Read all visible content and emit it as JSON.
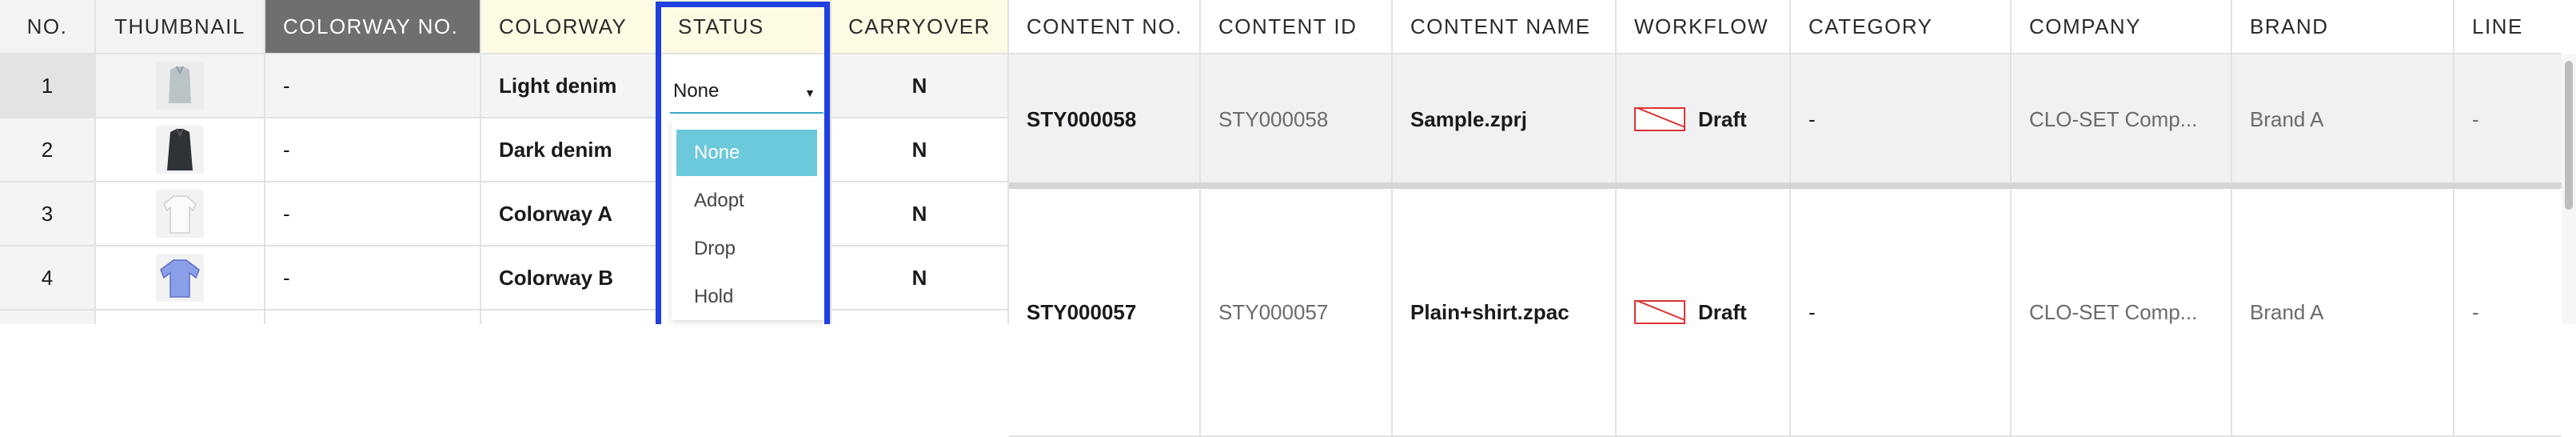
{
  "columns": {
    "no": "NO.",
    "thumbnail": "THUMBNAIL",
    "colorway_no": "COLORWAY NO.",
    "colorway": "COLORWAY",
    "status": "STATUS",
    "carryover": "CARRYOVER",
    "content_no": "CONTENT NO.",
    "content_id": "CONTENT ID",
    "content_name": "CONTENT NAME",
    "workflow": "WORKFLOW",
    "category": "CATEGORY",
    "company": "COMPANY",
    "brand": "BRAND",
    "line": "LINE"
  },
  "colorway_rows": [
    {
      "no": "1",
      "colorway_no": "-",
      "colorway": "Light denim",
      "carryover": "N",
      "thumb": "light-denim-garment-icon"
    },
    {
      "no": "2",
      "colorway_no": "-",
      "colorway": "Dark denim",
      "carryover": "N",
      "thumb": "dark-denim-garment-icon"
    },
    {
      "no": "3",
      "colorway_no": "-",
      "colorway": "Colorway A",
      "carryover": "N",
      "thumb": "white-shirt-icon"
    },
    {
      "no": "4",
      "colorway_no": "-",
      "colorway": "Colorway B",
      "carryover": "N",
      "thumb": "blue-shirt-icon"
    }
  ],
  "status_select": {
    "value": "None",
    "options": [
      "None",
      "Adopt",
      "Drop",
      "Hold"
    ],
    "selected_index": 0
  },
  "content_rows": [
    {
      "content_no": "STY000058",
      "content_id": "STY000058",
      "content_name": "Sample.zprj",
      "workflow": "Draft",
      "category": "-",
      "company": "CLO-SET Comp...",
      "brand": "Brand A",
      "line": "-"
    },
    {
      "content_no": "STY000057",
      "content_id": "STY000057",
      "content_name": "Plain+shirt.zpac",
      "workflow": "Draft",
      "category": "-",
      "company": "CLO-SET Comp...",
      "brand": "Brand A",
      "line": "-"
    }
  ],
  "colors": {
    "highlight_border": "#1f3fe0",
    "dropdown_selected": "#6cc9dc",
    "header_dark": "#6f6f6f",
    "header_yellow": "#fdfbe3",
    "selected_row": "#f1f1f3"
  }
}
